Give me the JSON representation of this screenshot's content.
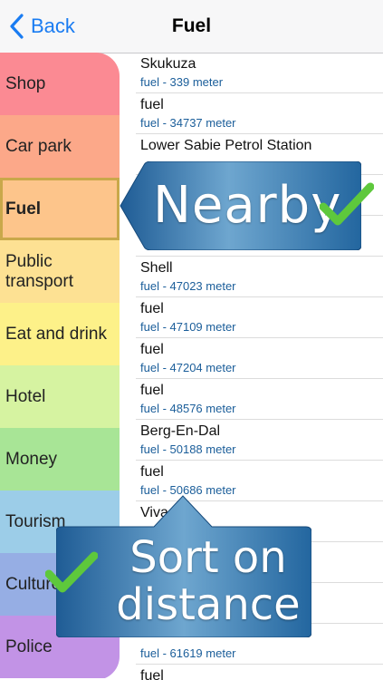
{
  "nav": {
    "back_label": "Back",
    "title": "Fuel"
  },
  "sidebar": {
    "items": [
      {
        "label": "Shop",
        "color": "#fb8a93"
      },
      {
        "label": "Car park",
        "color": "#fca889"
      },
      {
        "label": "Fuel",
        "color": "#fdc58b",
        "selected": true
      },
      {
        "label": "Public transport",
        "color": "#fde193"
      },
      {
        "label": "Eat and drink",
        "color": "#fdf189"
      },
      {
        "label": "Hotel",
        "color": "#d6f3a1"
      },
      {
        "label": "Money",
        "color": "#a8e596"
      },
      {
        "label": "Tourism",
        "color": "#9ccde8"
      },
      {
        "label": "Culture",
        "color": "#96aee4"
      },
      {
        "label": "Police",
        "color": "#c293e6"
      }
    ]
  },
  "list": {
    "rows": [
      {
        "name": "Skukuza",
        "sub": "fuel - 339 meter"
      },
      {
        "name": "fuel",
        "sub": "fuel - 34737 meter"
      },
      {
        "name": "Lower Sabie Petrol Station",
        "sub": ""
      },
      {
        "name": "",
        "sub": ""
      },
      {
        "name": "",
        "sub": ""
      },
      {
        "name": "Shell",
        "sub": "fuel - 47023 meter"
      },
      {
        "name": "fuel",
        "sub": "fuel - 47109 meter"
      },
      {
        "name": "fuel",
        "sub": "fuel - 47204 meter"
      },
      {
        "name": "fuel",
        "sub": "fuel - 48576 meter"
      },
      {
        "name": "Berg-En-Dal",
        "sub": "fuel - 50188 meter"
      },
      {
        "name": "fuel",
        "sub": "fuel - 50686 meter"
      },
      {
        "name": "Viva",
        "sub": ""
      },
      {
        "name": "",
        "sub": ""
      },
      {
        "name": "",
        "sub": ""
      },
      {
        "name": "",
        "sub": "fuel - 61619 meter"
      },
      {
        "name": "fuel",
        "sub": ""
      }
    ]
  },
  "callouts": {
    "nearby": "Nearby",
    "sort_line1": "Sort on",
    "sort_line2": "distance",
    "check_color": "#5ec83c"
  },
  "colors": {
    "accent": "#1a7cf2",
    "subtitle": "#1b5e9a",
    "callout_blue": "#2f6fa9"
  }
}
